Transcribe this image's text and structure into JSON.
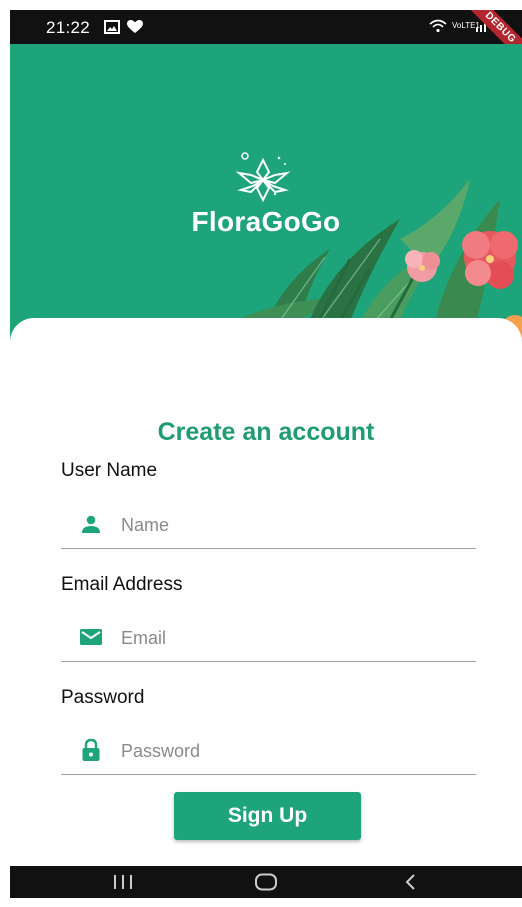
{
  "status_bar": {
    "time": "21:22",
    "debug_banner": "DEBUG",
    "network_label": "VoLTE1"
  },
  "header": {
    "brand_name": "FloraGoGo",
    "background_color": "#1da47a"
  },
  "form": {
    "title": "Create an account",
    "fields": [
      {
        "label": "User Name",
        "placeholder": "Name",
        "value": "",
        "icon": "person-icon"
      },
      {
        "label": "Email Address",
        "placeholder": "Email",
        "value": "",
        "icon": "mail-icon"
      },
      {
        "label": "Password",
        "placeholder": "Password",
        "value": "",
        "icon": "lock-icon"
      }
    ],
    "submit_label": "Sign Up"
  },
  "nav_bar": {
    "buttons": [
      "recent-apps-icon",
      "home-icon",
      "back-icon"
    ]
  },
  "colors": {
    "accent": "#1da47a",
    "title": "#1f9c73",
    "debug_ribbon": "#b3262e"
  }
}
